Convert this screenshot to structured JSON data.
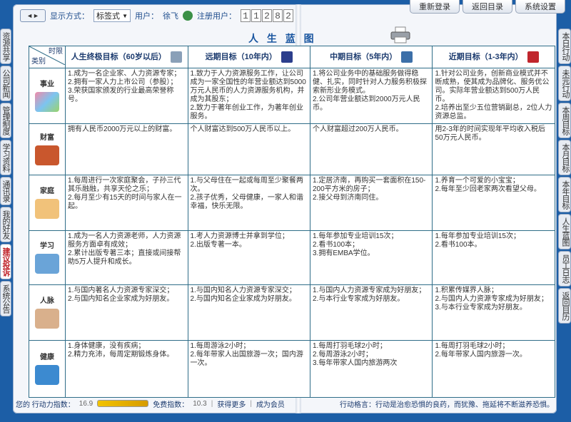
{
  "topbar": {
    "nav_label": "◄►",
    "display_mode_label": "显示方式：",
    "display_mode_value": "标签式",
    "user_label": "用户：",
    "user_name": "徐飞",
    "registered_label": "注册用户：",
    "registered_count": [
      "1",
      "1",
      "2",
      "8",
      "2"
    ]
  },
  "top_buttons": [
    "重新登录",
    "返回目录",
    "系统设置"
  ],
  "left_tabs": [
    {
      "label": "资源共享",
      "active": false
    },
    {
      "label": "公司新闻",
      "active": false
    },
    {
      "label": "管理制度",
      "active": false
    },
    {
      "label": "学习资料",
      "active": false
    },
    {
      "label": "通讯录",
      "active": false
    },
    {
      "label": "我的好友",
      "active": false
    },
    {
      "label": "建议投诉",
      "active": true
    },
    {
      "label": "系统公告",
      "active": false
    }
  ],
  "right_tabs": [
    "本日行动",
    "未完行动",
    "本周目标",
    "本月目标",
    "本年目标",
    "人生蓝图",
    "员工日志",
    "返回目历"
  ],
  "page_title": "人 生 蓝 图",
  "table": {
    "corner_top": "时限",
    "corner_bottom": "类别",
    "headers": [
      "人生终极目标（60岁以后）",
      "远期目标（10年内）",
      "中期目标（5年内）",
      "近期目标（1-3年内）"
    ],
    "rows": [
      {
        "label": "事业",
        "cells": [
          "1.成为一名企业家、人力资源专家；\n2.拥有一家人力上市公司（参股）；\n3.荣获国家颁发的行业最高荣誉称号。",
          "1.致力于人力资源服务工作，让公司成为一家全国性的年营业额达到5000万元人民币的人力资源服务机构，并成为其股东；\n2.致力于著年创业工作，为著年创业服务。",
          "1.将公司业务中的基础服务做得稳健、扎实，同时针对人力服务积极探索新形业务模式。\n2.公司年营业额达到2000万元人民币。",
          "1.针对公司业务，创新商业模式并不断成熟，使其成为品牌化、服务优公司。实际年营业额达到500万人民币。\n2.培养出至少五位营销副总，2位人力资源总监。"
        ]
      },
      {
        "label": "财富",
        "cells": [
          "拥有人民币2000万元以上的财富。",
          "个人财富达到500万人民币以上。",
          "个人财富超过200万人民币。",
          "用2-3年的时间实现年平均收入税后50万元人民币。"
        ]
      },
      {
        "label": "家庭",
        "cells": [
          "1.每周进行一次家庭聚会，子孙三代其乐融融，共享天伦之乐；\n2.每月至少有15天的时间与家人在一起。",
          "1.与父母住在一起或每周至少聚餐两次。\n2.孩子优秀，父母健康，一家人和谐幸福，快乐无限。",
          "1.定居济南，再购买一套面积在150-200平方米的房子；\n2.接父母到济南同住。",
          "1.养育一个可爱的小宝宝；\n2.每年至少回老家两次看望父母。"
        ]
      },
      {
        "label": "学习",
        "cells": [
          "1.成为一名人力资源老师，人力资源服务方面卓有成效；\n2.累计出版专著三本；直接或间接帮助5万人提升和成长。",
          "1.考人力资源博士并拿到学位；\n2.出版专著一本。",
          "1.每年参加专业培训15次；\n2.看书100本；\n3.拥有EMBA学位。",
          "1.每年参加专业培训15次；\n2.看书100本。"
        ]
      },
      {
        "label": "人脉",
        "cells": [
          "1.与国内著名人力资源专家深交；\n2.与国内知名企业家成为好朋友。",
          "1.与国内知名人力资源专家深交；\n2.与国内知名企业家成为好朋友。",
          "1.与国内人力资源专家成为好朋友；\n2.与本行业专家成为好朋友。",
          "1.积累传媒界人脉；\n2.与国内人力资源专家成为好朋友；\n3.与本行业专家成为好朋友。"
        ]
      },
      {
        "label": "健康",
        "cells": [
          "1.身体健康，没有疾病；\n2.精力充沛，每周定期锻炼身体。",
          "1.每周游泳2小时；\n2.每年带家人出国旅游一次；国内游一次。",
          "1.每周打羽毛球2小时；\n2.每周游泳2小时；\n3.每年带家人国内旅游两次",
          "1.每周打羽毛球2小时；\n2.每年带家人国内旅游一次。"
        ]
      }
    ]
  },
  "bottom": {
    "action_index_label": "您的 行动力指数：",
    "action_index_value": "16.9",
    "action_index_progress": 0.169,
    "free_index_label": "免费指数：",
    "free_index_value": "10.3",
    "more_link": "获得更多",
    "member_link": "成为会员",
    "motto_label": "行动格言：",
    "motto_text": "行动是治愈恐惧的良药，而犹豫、拖延将不断滋养恐惧。"
  },
  "colors": {
    "frame_blue": "#1c5ea6",
    "grid_line": "#2f6d88",
    "title_blue": "#1a56a0",
    "active_tab_red": "#c0262d"
  }
}
